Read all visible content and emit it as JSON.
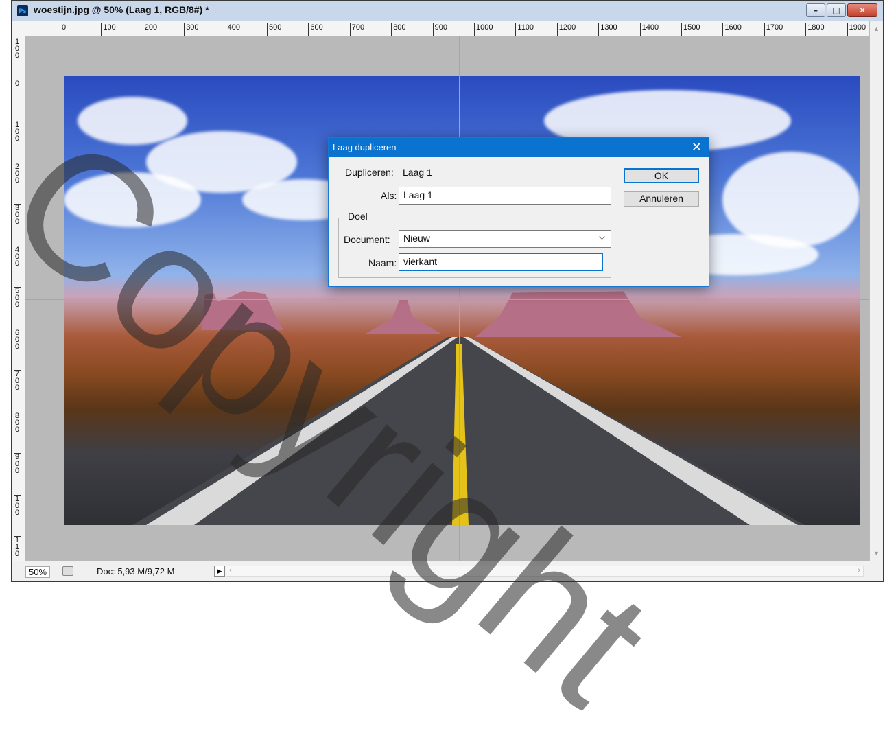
{
  "window": {
    "app_icon": "Ps",
    "title": "woestijn.jpg @ 50% (Laag 1, RGB/8#) *",
    "controls": {
      "minimize_icon": "minimize-icon",
      "maximize_icon": "maximize-icon",
      "close_icon": "close-icon"
    }
  },
  "ruler_top": [
    "0",
    "100",
    "200",
    "300",
    "400",
    "500",
    "600",
    "700",
    "800",
    "900",
    "1000",
    "1100",
    "1200",
    "1300",
    "1400",
    "1500",
    "1600",
    "1700",
    "1800",
    "1900"
  ],
  "ruler_left": [
    "1\n0\n0",
    "0",
    "1\n0\n0",
    "2\n0\n0",
    "3\n0\n0",
    "4\n0\n0",
    "5\n0\n0",
    "6\n0\n0",
    "7\n0\n0",
    "8\n0\n0",
    "9\n0\n0",
    "1\n0\n0",
    "1\n1\n0"
  ],
  "statusbar": {
    "zoom": "50%",
    "doc": "Doc: 5,93 M/9,72 M"
  },
  "dialog": {
    "title": "Laag dupliceren",
    "duplicate_label": "Dupliceren:",
    "duplicate_value": "Laag 1",
    "as_label": "Als:",
    "as_value": "Laag 1",
    "target_group": "Doel",
    "document_label": "Document:",
    "document_value": "Nieuw",
    "name_label": "Naam:",
    "name_value": "vierkant",
    "ok_label": "OK",
    "cancel_label": "Annuleren"
  },
  "watermark": {
    "text": "Copyright"
  }
}
